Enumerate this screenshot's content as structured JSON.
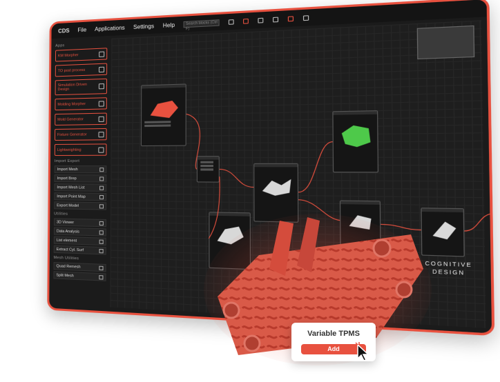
{
  "menubar": {
    "logo": "CDS",
    "menu": [
      "File",
      "Applications",
      "Settings",
      "Help"
    ],
    "search_placeholder": "Search blocks (Ctrl F)"
  },
  "sidebar": {
    "apps_title": "Apps",
    "apps": [
      "KM Morpher",
      "TO post process",
      "Simulation Driven Design",
      "Molding Morpher",
      "Mold Generator",
      "Fixture Generator",
      "Lightweighting"
    ],
    "import_export_title": "Import Export",
    "import_export": [
      "Import Mesh",
      "Import Brep",
      "Import Mesh List",
      "Import Point Map",
      "Export Model"
    ],
    "utilities_title": "Utilities",
    "utilities": [
      "3D Viewer",
      "Data Analysis",
      "List element",
      "Extract Cyl. Surf"
    ],
    "mesh_utilities_title": "Mesh Utilities",
    "mesh_utilities": [
      "Quad Remesh",
      "Split Mesh"
    ]
  },
  "brand": {
    "line1": "COGNITIVE",
    "line2": "DESIGN"
  },
  "popup": {
    "title": "Variable TPMS",
    "button": "Add"
  },
  "colors": {
    "accent": "#e8513f",
    "green": "#4ec94a",
    "dark": "#1b1b1b"
  }
}
